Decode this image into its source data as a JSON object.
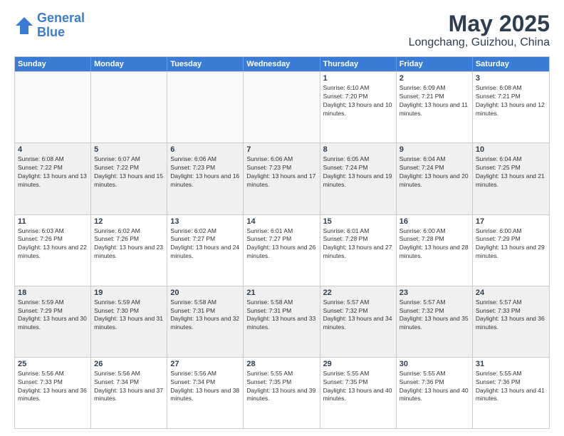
{
  "header": {
    "logo_line1": "General",
    "logo_line2": "Blue",
    "main_title": "May 2025",
    "subtitle": "Longchang, Guizhou, China"
  },
  "days_of_week": [
    "Sunday",
    "Monday",
    "Tuesday",
    "Wednesday",
    "Thursday",
    "Friday",
    "Saturday"
  ],
  "rows": [
    [
      {
        "day": "",
        "empty": true
      },
      {
        "day": "",
        "empty": true
      },
      {
        "day": "",
        "empty": true
      },
      {
        "day": "",
        "empty": true
      },
      {
        "day": "1",
        "sunrise": "6:10 AM",
        "sunset": "7:20 PM",
        "daylight": "13 hours and 10 minutes."
      },
      {
        "day": "2",
        "sunrise": "6:09 AM",
        "sunset": "7:21 PM",
        "daylight": "13 hours and 11 minutes."
      },
      {
        "day": "3",
        "sunrise": "6:08 AM",
        "sunset": "7:21 PM",
        "daylight": "13 hours and 12 minutes."
      }
    ],
    [
      {
        "day": "4",
        "sunrise": "6:08 AM",
        "sunset": "7:22 PM",
        "daylight": "13 hours and 13 minutes.",
        "shaded": true
      },
      {
        "day": "5",
        "sunrise": "6:07 AM",
        "sunset": "7:22 PM",
        "daylight": "13 hours and 15 minutes.",
        "shaded": true
      },
      {
        "day": "6",
        "sunrise": "6:06 AM",
        "sunset": "7:23 PM",
        "daylight": "13 hours and 16 minutes.",
        "shaded": true
      },
      {
        "day": "7",
        "sunrise": "6:06 AM",
        "sunset": "7:23 PM",
        "daylight": "13 hours and 17 minutes.",
        "shaded": true
      },
      {
        "day": "8",
        "sunrise": "6:05 AM",
        "sunset": "7:24 PM",
        "daylight": "13 hours and 19 minutes.",
        "shaded": true
      },
      {
        "day": "9",
        "sunrise": "6:04 AM",
        "sunset": "7:24 PM",
        "daylight": "13 hours and 20 minutes.",
        "shaded": true
      },
      {
        "day": "10",
        "sunrise": "6:04 AM",
        "sunset": "7:25 PM",
        "daylight": "13 hours and 21 minutes.",
        "shaded": true
      }
    ],
    [
      {
        "day": "11",
        "sunrise": "6:03 AM",
        "sunset": "7:26 PM",
        "daylight": "13 hours and 22 minutes."
      },
      {
        "day": "12",
        "sunrise": "6:02 AM",
        "sunset": "7:26 PM",
        "daylight": "13 hours and 23 minutes."
      },
      {
        "day": "13",
        "sunrise": "6:02 AM",
        "sunset": "7:27 PM",
        "daylight": "13 hours and 24 minutes."
      },
      {
        "day": "14",
        "sunrise": "6:01 AM",
        "sunset": "7:27 PM",
        "daylight": "13 hours and 26 minutes."
      },
      {
        "day": "15",
        "sunrise": "6:01 AM",
        "sunset": "7:28 PM",
        "daylight": "13 hours and 27 minutes."
      },
      {
        "day": "16",
        "sunrise": "6:00 AM",
        "sunset": "7:28 PM",
        "daylight": "13 hours and 28 minutes."
      },
      {
        "day": "17",
        "sunrise": "6:00 AM",
        "sunset": "7:29 PM",
        "daylight": "13 hours and 29 minutes."
      }
    ],
    [
      {
        "day": "18",
        "sunrise": "5:59 AM",
        "sunset": "7:29 PM",
        "daylight": "13 hours and 30 minutes.",
        "shaded": true
      },
      {
        "day": "19",
        "sunrise": "5:59 AM",
        "sunset": "7:30 PM",
        "daylight": "13 hours and 31 minutes.",
        "shaded": true
      },
      {
        "day": "20",
        "sunrise": "5:58 AM",
        "sunset": "7:31 PM",
        "daylight": "13 hours and 32 minutes.",
        "shaded": true
      },
      {
        "day": "21",
        "sunrise": "5:58 AM",
        "sunset": "7:31 PM",
        "daylight": "13 hours and 33 minutes.",
        "shaded": true
      },
      {
        "day": "22",
        "sunrise": "5:57 AM",
        "sunset": "7:32 PM",
        "daylight": "13 hours and 34 minutes.",
        "shaded": true
      },
      {
        "day": "23",
        "sunrise": "5:57 AM",
        "sunset": "7:32 PM",
        "daylight": "13 hours and 35 minutes.",
        "shaded": true
      },
      {
        "day": "24",
        "sunrise": "5:57 AM",
        "sunset": "7:33 PM",
        "daylight": "13 hours and 36 minutes.",
        "shaded": true
      }
    ],
    [
      {
        "day": "25",
        "sunrise": "5:56 AM",
        "sunset": "7:33 PM",
        "daylight": "13 hours and 36 minutes."
      },
      {
        "day": "26",
        "sunrise": "5:56 AM",
        "sunset": "7:34 PM",
        "daylight": "13 hours and 37 minutes."
      },
      {
        "day": "27",
        "sunrise": "5:56 AM",
        "sunset": "7:34 PM",
        "daylight": "13 hours and 38 minutes."
      },
      {
        "day": "28",
        "sunrise": "5:55 AM",
        "sunset": "7:35 PM",
        "daylight": "13 hours and 39 minutes."
      },
      {
        "day": "29",
        "sunrise": "5:55 AM",
        "sunset": "7:35 PM",
        "daylight": "13 hours and 40 minutes."
      },
      {
        "day": "30",
        "sunrise": "5:55 AM",
        "sunset": "7:36 PM",
        "daylight": "13 hours and 40 minutes."
      },
      {
        "day": "31",
        "sunrise": "5:55 AM",
        "sunset": "7:36 PM",
        "daylight": "13 hours and 41 minutes."
      }
    ]
  ]
}
